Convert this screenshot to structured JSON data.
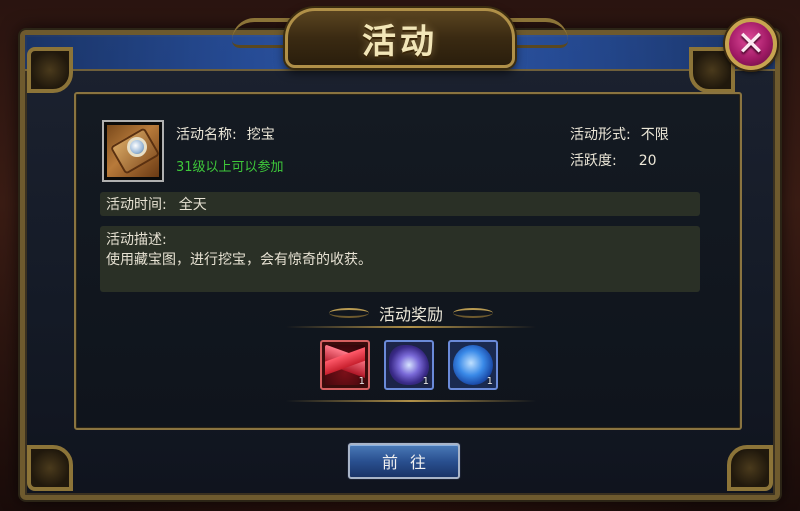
{
  "window": {
    "title": "活动",
    "close_label": "✕"
  },
  "activity": {
    "icon": "treasure-map-icon",
    "name_label": "活动名称:",
    "name_value": "挖宝",
    "requirement": "31级以上可以参加",
    "form_label": "活动形式:",
    "form_value": "不限",
    "activity_label": "活跃度:",
    "activity_value": "20",
    "time_label": "活动时间:",
    "time_value": "全天",
    "desc_label": "活动描述:",
    "desc_value": "使用藏宝图，进行挖宝，会有惊奇的收获。"
  },
  "rewards": {
    "title": "活动奖励",
    "items": [
      {
        "icon": "red-crystal-icon",
        "quantity": "1"
      },
      {
        "icon": "purple-gem-icon",
        "quantity": "1"
      },
      {
        "icon": "blue-orb-icon",
        "quantity": "1"
      }
    ]
  },
  "buttons": {
    "go_label": "前往"
  },
  "colors": {
    "requirement_text": "#3ec83a",
    "gold_border": "#8a7440",
    "button_blue": "#2a5090",
    "close_magenta": "#a21a66"
  }
}
